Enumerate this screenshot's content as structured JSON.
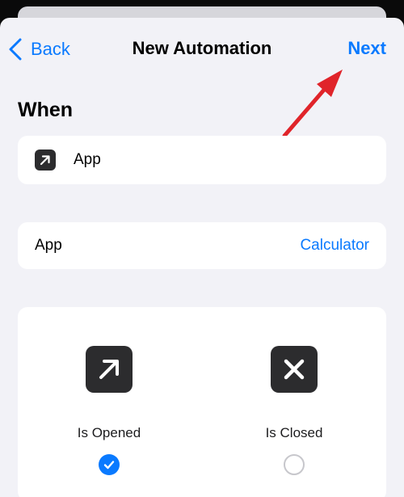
{
  "nav": {
    "back_label": "Back",
    "title": "New Automation",
    "next_label": "Next"
  },
  "section": {
    "title": "When"
  },
  "trigger": {
    "label": "App",
    "icon": "arrow-up-right-icon"
  },
  "app_row": {
    "label": "App",
    "value": "Calculator"
  },
  "options": [
    {
      "label": "Is Opened",
      "icon": "arrow-up-right-icon",
      "selected": true
    },
    {
      "label": "Is Closed",
      "icon": "close-x-icon",
      "selected": false
    }
  ],
  "colors": {
    "accent": "#0a7aff",
    "background": "#f2f2f7",
    "card": "#ffffff",
    "icon_tile": "#2c2c2e",
    "annotation_arrow": "#e0242a"
  }
}
